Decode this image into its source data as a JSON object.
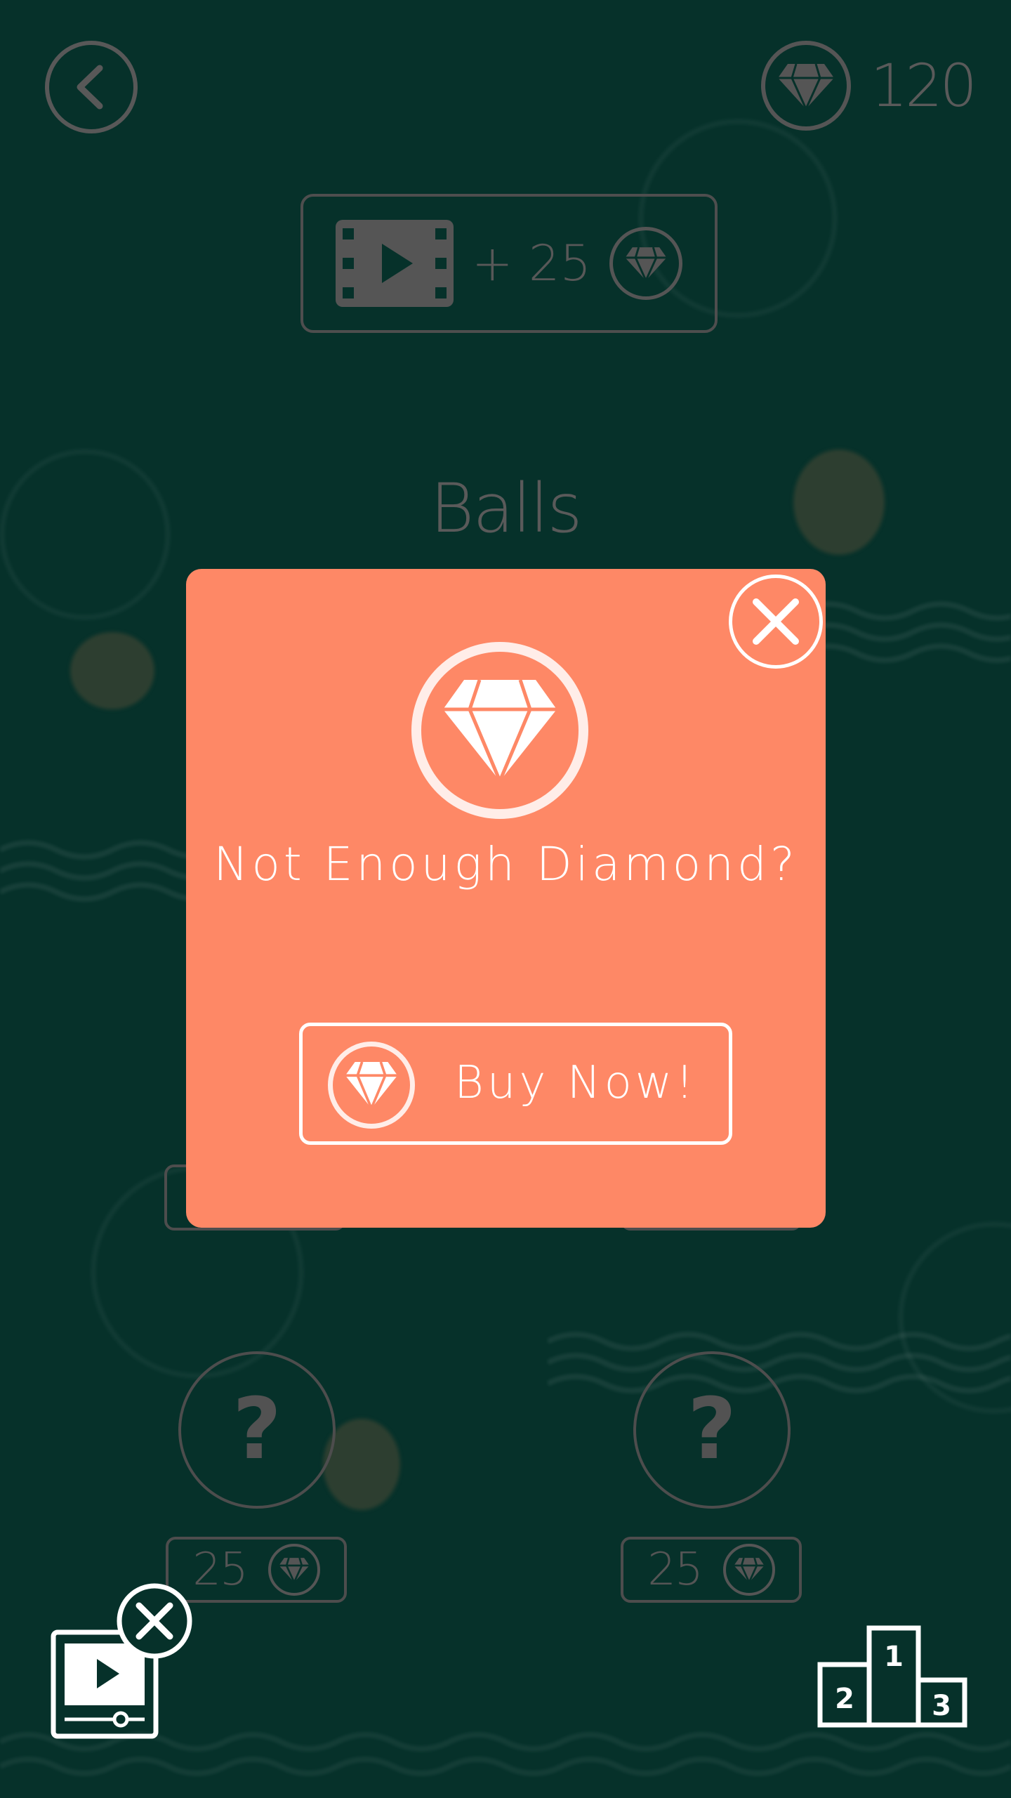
{
  "header": {
    "back_icon": "chevron-left-icon",
    "diamond_count": "120"
  },
  "video_reward": {
    "icon": "film-play-icon",
    "label": "+ 25",
    "currency_icon": "diamond-icon"
  },
  "section": {
    "title": "Balls"
  },
  "ball_items": [
    {
      "placeholder": "?",
      "price": "25"
    },
    {
      "placeholder": "?",
      "price": "25"
    }
  ],
  "dialog": {
    "title": "Not Enough Diamond?",
    "buy_label": "Buy Now!",
    "close_icon": "close-icon",
    "icon": "diamond-icon"
  },
  "footer": {
    "no_ads_icon": "no-video-ads-icon",
    "leaderboard_icon": "podium-icon",
    "podium_labels": [
      "1",
      "2",
      "3"
    ]
  },
  "colors": {
    "background": "#06312a",
    "dialog": "#fe8866",
    "muted": "#555555",
    "white": "#ffffff"
  }
}
